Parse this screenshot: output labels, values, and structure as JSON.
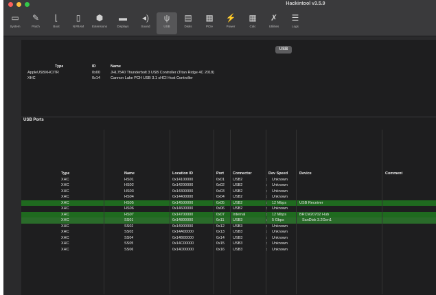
{
  "window": {
    "title": "Hackintool v3.5.9"
  },
  "toolbar": [
    {
      "label": "System",
      "icon": "monitor-icon",
      "glyph": "▭"
    },
    {
      "label": "Patch",
      "icon": "pen-icon",
      "glyph": "✎"
    },
    {
      "label": "Boot",
      "icon": "boot-icon",
      "glyph": "⌊"
    },
    {
      "label": "NVRAM",
      "icon": "memory-icon",
      "glyph": "▯"
    },
    {
      "label": "Extensions",
      "icon": "extension-icon",
      "glyph": "⬢"
    },
    {
      "label": "Displays",
      "icon": "display-icon",
      "glyph": "▬"
    },
    {
      "label": "Sound",
      "icon": "speaker-icon",
      "glyph": "◂)"
    },
    {
      "label": "USB",
      "icon": "usb-icon",
      "glyph": "ψ"
    },
    {
      "label": "Disks",
      "icon": "disk-icon",
      "glyph": "▤"
    },
    {
      "label": "PCIe",
      "icon": "pcie-icon",
      "glyph": "▦"
    },
    {
      "label": "Power",
      "icon": "power-icon",
      "glyph": "⚡"
    },
    {
      "label": "Calc",
      "icon": "calculator-icon",
      "glyph": "▦"
    },
    {
      "label": "Utilities",
      "icon": "wrench-icon",
      "glyph": "✗"
    },
    {
      "label": "Logs",
      "icon": "logs-icon",
      "glyph": "☰"
    }
  ],
  "usb_pill": "USB",
  "controllers": {
    "headers": [
      "Type",
      "ID",
      "Name"
    ],
    "rows": [
      [
        "AppleUSBXHCITR",
        "0x00",
        "JHL7540 Thunderbolt 3 USB Controller (Titan Ridge 4C 2018)"
      ],
      [
        "XHC",
        "0x14",
        "Cannon Lake PCH USB 3.1 xHCI Host Controller"
      ]
    ]
  },
  "ports_section_label": "USB Ports",
  "ports": {
    "headers": [
      "Type",
      "Name",
      "Location ID",
      "Port",
      "Connector",
      "Dev Speed",
      "Device",
      "Comment"
    ],
    "rows": [
      {
        "type": "XHC",
        "name": "HS01",
        "loc": "0x14100000",
        "port": "0x01",
        "conn": "USB2",
        "speed": "Unknown",
        "device": "",
        "hl": ""
      },
      {
        "type": "XHC",
        "name": "HS02",
        "loc": "0x14200000",
        "port": "0x02",
        "conn": "USB2",
        "speed": "Unknown",
        "device": "",
        "hl": ""
      },
      {
        "type": "XHC",
        "name": "HS03",
        "loc": "0x14300000",
        "port": "0x03",
        "conn": "USB2",
        "speed": "Unknown",
        "device": "",
        "hl": ""
      },
      {
        "type": "XHC",
        "name": "HS04",
        "loc": "0x14400000",
        "port": "0x04",
        "conn": "USB2",
        "speed": "Unknown",
        "device": "",
        "hl": ""
      },
      {
        "type": "XHC",
        "name": "HS05",
        "loc": "0x14500000",
        "port": "0x05",
        "conn": "USB2",
        "speed": "12 Mbps",
        "device": "USB Receiver",
        "hl": "green"
      },
      {
        "type": "XHC",
        "name": "HS06",
        "loc": "0x14600000",
        "port": "0x06",
        "conn": "USB2",
        "speed": "Unknown",
        "device": "",
        "hl": ""
      },
      {
        "type": "XHC",
        "name": "HS07",
        "loc": "0x14700000",
        "port": "0x07",
        "conn": "Internal",
        "speed": "12 Mbps",
        "device": "BRCM20702 Hub",
        "hl": "green"
      },
      {
        "type": "XHC",
        "name": "SS01",
        "loc": "0x14800000",
        "port": "0x11",
        "conn": "USB3",
        "speed": "5 Gbps",
        "device": "SanDisk 3.2Gen1",
        "hl": "green2"
      },
      {
        "type": "XHC",
        "name": "SS02",
        "loc": "0x14900000",
        "port": "0x12",
        "conn": "USB3",
        "speed": "Unknown",
        "device": "",
        "hl": ""
      },
      {
        "type": "XHC",
        "name": "SS03",
        "loc": "0x14A00000",
        "port": "0x13",
        "conn": "USB3",
        "speed": "Unknown",
        "device": "",
        "hl": ""
      },
      {
        "type": "XHC",
        "name": "SS04",
        "loc": "0x14B00000",
        "port": "0x14",
        "conn": "USB3",
        "speed": "Unknown",
        "device": "",
        "hl": ""
      },
      {
        "type": "XHC",
        "name": "SS05",
        "loc": "0x14C00000",
        "port": "0x15",
        "conn": "USB3",
        "speed": "Unknown",
        "device": "",
        "hl": ""
      },
      {
        "type": "XHC",
        "name": "SS06",
        "loc": "0x14D00000",
        "port": "0x16",
        "conn": "USB3",
        "speed": "Unknown",
        "device": "",
        "hl": ""
      }
    ]
  }
}
